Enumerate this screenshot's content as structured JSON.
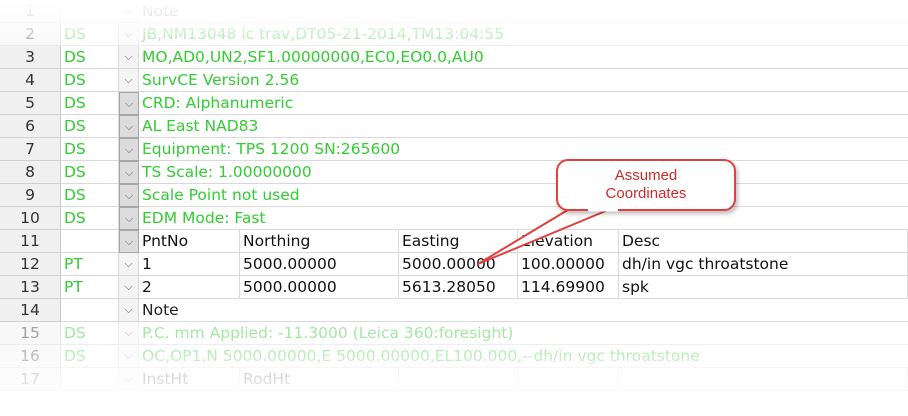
{
  "rows": [
    {
      "num": "1",
      "code": "",
      "dd_dark": false,
      "wide": "Note",
      "style": "faded"
    },
    {
      "num": "2",
      "code": "DS",
      "dd_dark": false,
      "wide": "JB,NM13048 lc trav,DT05-21-2014,TM13:04:55",
      "style": "faded"
    },
    {
      "num": "3",
      "code": "DS",
      "dd_dark": false,
      "wide": "MO,AD0,UN2,SF1.00000000,EC0,EO0.0,AU0",
      "style": "green"
    },
    {
      "num": "4",
      "code": "DS",
      "dd_dark": false,
      "wide": "SurvCE Version 2.56",
      "style": "green"
    },
    {
      "num": "5",
      "code": "DS",
      "dd_dark": true,
      "wide": "CRD: Alphanumeric",
      "style": "green"
    },
    {
      "num": "6",
      "code": "DS",
      "dd_dark": true,
      "wide": "AL East NAD83",
      "style": "green"
    },
    {
      "num": "7",
      "code": "DS",
      "dd_dark": true,
      "wide": "Equipment: TPS 1200  SN:265600",
      "style": "green"
    },
    {
      "num": "8",
      "code": "DS",
      "dd_dark": true,
      "wide": "TS Scale: 1.00000000",
      "style": "green"
    },
    {
      "num": "9",
      "code": "DS",
      "dd_dark": true,
      "wide": "Scale Point not used",
      "style": "green"
    },
    {
      "num": "10",
      "code": "DS",
      "dd_dark": true,
      "wide": "EDM Mode: Fast",
      "style": "green"
    },
    {
      "num": "11",
      "code": "",
      "dd_dark": true,
      "cols": [
        "PntNo",
        "Northing",
        "Easting",
        "Elevation",
        "Desc"
      ],
      "style": "plain"
    },
    {
      "num": "12",
      "code": "PT",
      "dd_dark": false,
      "cols": [
        "1",
        "5000.00000",
        "5000.00000",
        "100.00000",
        "dh/in vgc throatstone"
      ],
      "style": "plain"
    },
    {
      "num": "13",
      "code": "PT",
      "dd_dark": false,
      "cols": [
        "2",
        "5000.00000",
        "5613.28050",
        "114.69900",
        "spk"
      ],
      "style": "plain"
    },
    {
      "num": "14",
      "code": "",
      "dd_dark": false,
      "wide": "Note",
      "style": "plain"
    },
    {
      "num": "15",
      "code": "DS",
      "dd_dark": false,
      "wide": "P.C. mm Applied: -11.3000 (Leica 360:foresight)",
      "style": "faded"
    },
    {
      "num": "16",
      "code": "DS",
      "dd_dark": false,
      "wide": "OC,OP1,N 5000.00000,E 5000.00000,EL100.000,--dh/in vgc throatstone",
      "style": "faded"
    },
    {
      "num": "17",
      "code": "",
      "dd_dark": false,
      "cols": [
        "InstHt",
        "RodHt"
      ],
      "style": "faded"
    }
  ],
  "dropdown_glyph": "⌵",
  "callout": {
    "line1": "Assumed",
    "line2": "Coordinates"
  },
  "colors": {
    "code_green": "#33cc33",
    "callout_red": "#e0413f"
  }
}
